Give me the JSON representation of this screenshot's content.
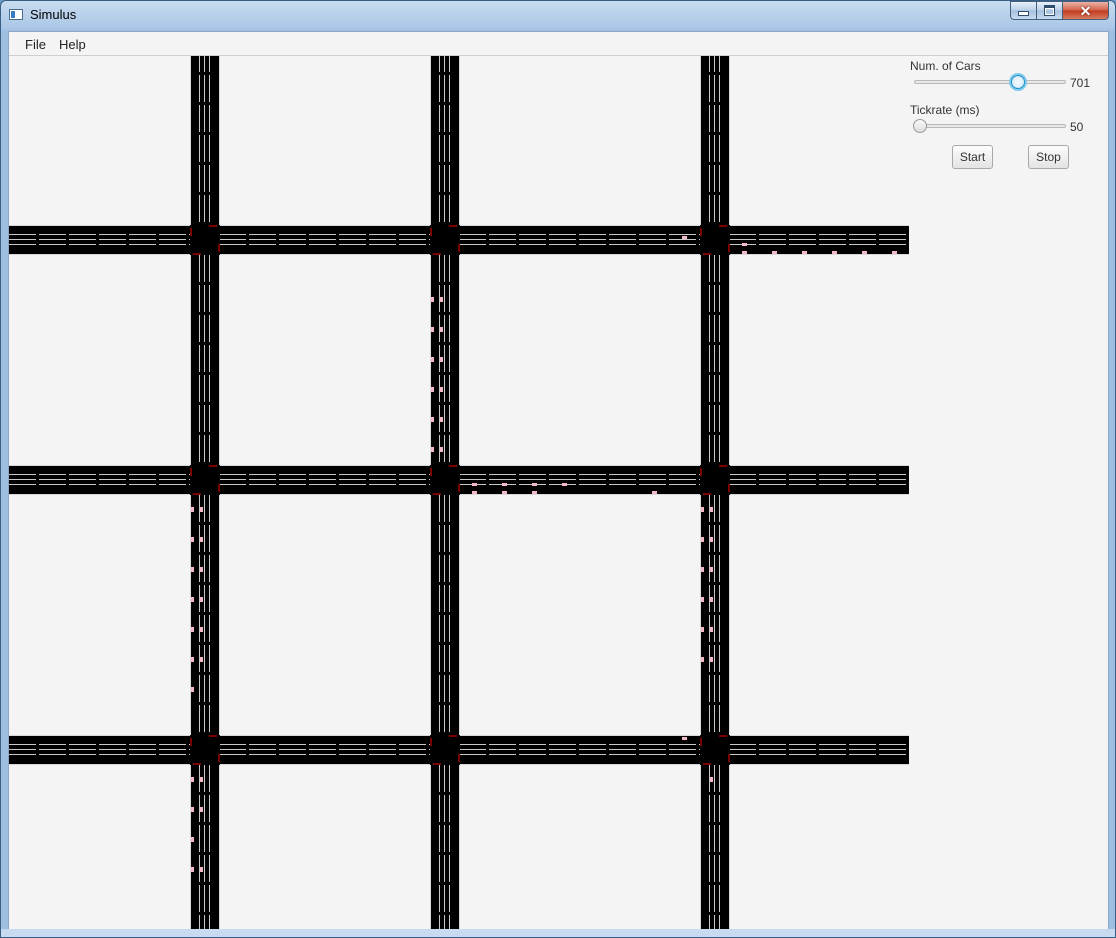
{
  "window": {
    "title": "Simulus"
  },
  "menu": {
    "file": "File",
    "help": "Help"
  },
  "controls": {
    "cars_label": "Num. of Cars",
    "cars_value": "701",
    "cars_slider_fraction": 0.7,
    "tick_label": "Tickrate (ms)",
    "tick_value": "50",
    "tick_slider_fraction": 0.0,
    "start_label": "Start",
    "stop_label": "Stop"
  },
  "colors": {
    "road": "#000000",
    "lane_marking": "#c8c8c8",
    "car": "#f2b8c6",
    "light_red": "#7a0000",
    "accent": "#1c8ec8"
  },
  "icons": {
    "app": "window-icon",
    "minimize": "minimize-icon",
    "maximize": "maximize-icon",
    "close": "close-icon"
  }
}
